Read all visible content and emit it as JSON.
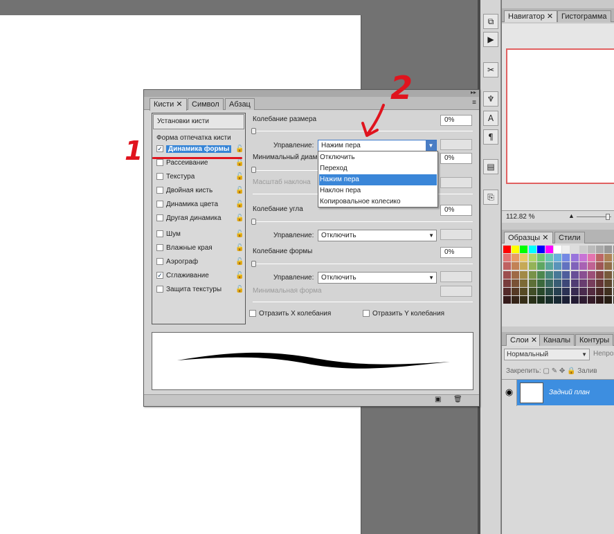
{
  "navigator_panel": {
    "tabs": [
      "Навигатор",
      "Гистограмма"
    ],
    "zoom": "112.82 %"
  },
  "swatches_panel": {
    "tabs": [
      "Образцы",
      "Стили"
    ]
  },
  "layers_panel": {
    "tabs": [
      "Слои",
      "Каналы",
      "Контуры"
    ],
    "blend_mode": "Нормальный",
    "opacity_label": "Непроз",
    "lock_label": "Закрепить:",
    "fill_label": "Залив",
    "layer_name": "Задний план"
  },
  "brush_panel": {
    "tabs": [
      "Кисти",
      "Символ",
      "Абзац"
    ],
    "settings_button": "Установки кисти",
    "tip_shape": "Форма отпечатка кисти",
    "items": [
      {
        "label": "Динамика формы",
        "checked": true,
        "selected": true
      },
      {
        "label": "Рассеивание",
        "checked": false
      },
      {
        "label": "Текстура",
        "checked": false
      },
      {
        "label": "Двойная кисть",
        "checked": false
      },
      {
        "label": "Динамика цвета",
        "checked": false
      },
      {
        "label": "Другая динамика",
        "checked": false
      },
      {
        "label": "Шум",
        "checked": false
      },
      {
        "label": "Влажные края",
        "checked": false
      },
      {
        "label": "Аэрограф",
        "checked": false
      },
      {
        "label": "Сглаживание",
        "checked": true
      },
      {
        "label": "Защита текстуры",
        "checked": false
      }
    ],
    "size_jitter_label": "Колебание размера",
    "size_jitter_value": "0%",
    "control_label": "Управление:",
    "size_control_value": "Нажим пера",
    "min_diameter_label": "Минимальный диам",
    "min_diameter_value": "0%",
    "tilt_scale_label": "Масштаб наклона",
    "angle_jitter_label": "Колебание угла",
    "angle_jitter_value": "0%",
    "angle_control_value": "Отключить",
    "roundness_jitter_label": "Колебание формы",
    "roundness_jitter_value": "0%",
    "roundness_control_value": "Отключить",
    "min_roundness_label": "Минимальная форма",
    "flip_x_label": "Отразить X колебания",
    "flip_y_label": "Отразить Y колебания"
  },
  "dropdown": {
    "options": [
      "Отключить",
      "Переход",
      "Нажим пера",
      "Наклон пера",
      "Копировальное колесико"
    ],
    "highlighted_index": 2
  },
  "annotations": {
    "one": "1",
    "two": "2"
  },
  "colors": {
    "selection_blue": "#3a86d8",
    "annotation_red": "#e0141e"
  }
}
